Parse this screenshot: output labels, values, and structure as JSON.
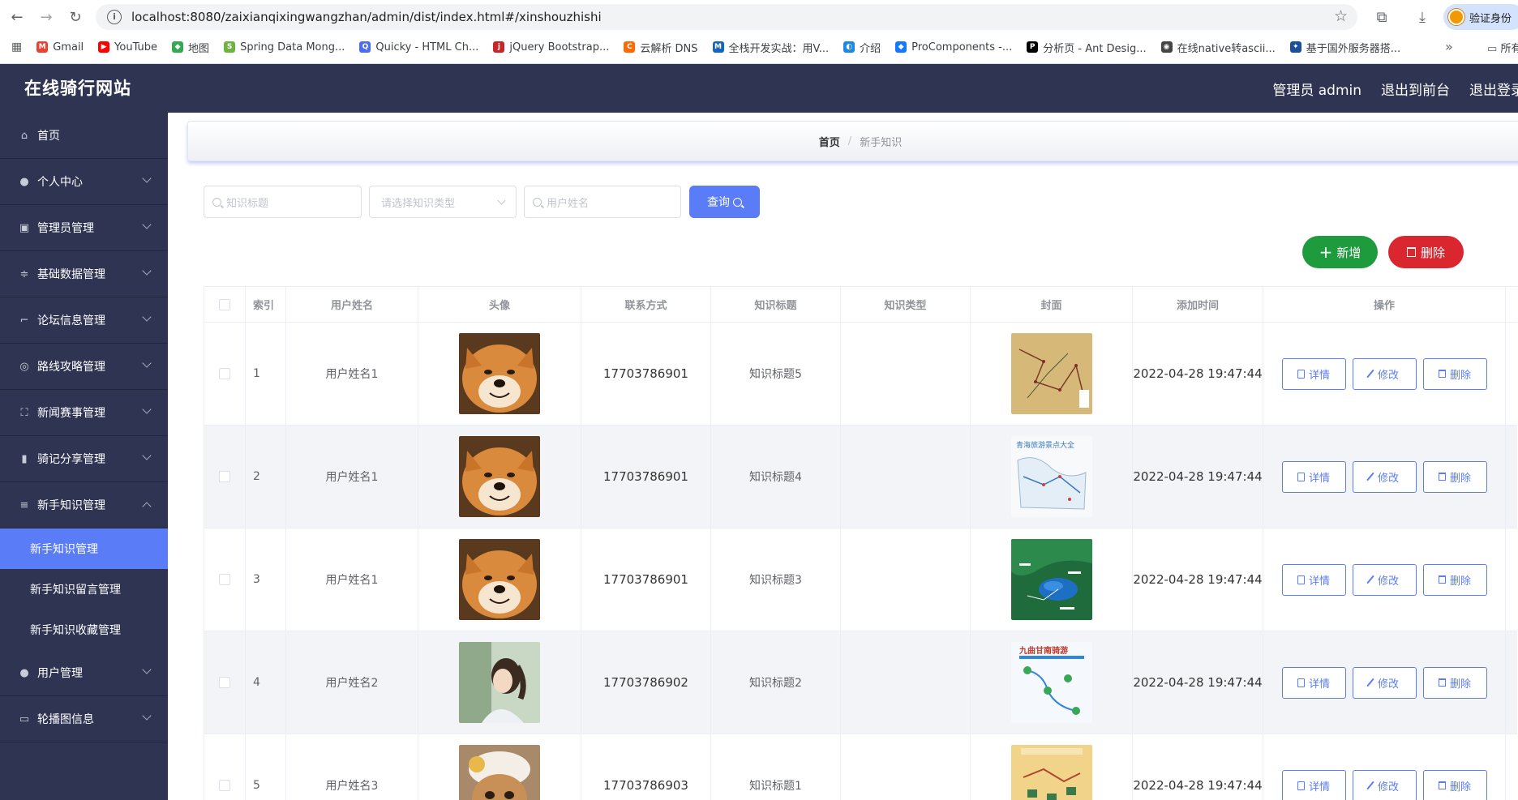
{
  "browser": {
    "url": "localhost:8080/zaixianqixingwangzhan/admin/dist/index.html#/xinshouzhishi",
    "profile_label": "验证身份",
    "bookmarks": [
      {
        "label": "Gmail",
        "color": "#ea4335",
        "glyph": "M"
      },
      {
        "label": "YouTube",
        "color": "#ff0000",
        "glyph": "▶"
      },
      {
        "label": "地图",
        "color": "#34a853",
        "glyph": "◆"
      },
      {
        "label": "Spring Data Mong...",
        "color": "#6db33f",
        "glyph": "S"
      },
      {
        "label": "Quicky - HTML Ch...",
        "color": "#4a6cf7",
        "glyph": "Q"
      },
      {
        "label": "jQuery Bootstrap...",
        "color": "#c62828",
        "glyph": "j"
      },
      {
        "label": "云解析 DNS",
        "color": "#ff6a00",
        "glyph": "C"
      },
      {
        "label": "全栈开发实战：用V...",
        "color": "#1565c0",
        "glyph": "M"
      },
      {
        "label": "介绍",
        "color": "#1e88e5",
        "glyph": "◐"
      },
      {
        "label": "ProComponents -...",
        "color": "#1677ff",
        "glyph": "◆"
      },
      {
        "label": "分析页 - Ant Desig...",
        "color": "#000000",
        "glyph": "P"
      },
      {
        "label": "在线native转ascii...",
        "color": "#444444",
        "glyph": "◉"
      },
      {
        "label": "基于国外服务器搭...",
        "color": "#1a4f9c",
        "glyph": "✦"
      }
    ],
    "bookmarks_overflow": "»",
    "bookmarks_more": "所有"
  },
  "header": {
    "title": "在线骑行网站",
    "admin_label": "管理员 admin",
    "frontend_label": "退出到前台",
    "logout_label": "退出登录"
  },
  "sidebar": {
    "items": [
      {
        "label": "首页",
        "icon": "home-icon",
        "expandable": false
      },
      {
        "label": "个人中心",
        "icon": "user-icon",
        "expandable": true
      },
      {
        "label": "管理员管理",
        "icon": "briefcase-icon",
        "expandable": true
      },
      {
        "label": "基础数据管理",
        "icon": "sliders-icon",
        "expandable": true
      },
      {
        "label": "论坛信息管理",
        "icon": "crop-icon",
        "expandable": true
      },
      {
        "label": "路线攻略管理",
        "icon": "compass-icon",
        "expandable": true
      },
      {
        "label": "新闻赛事管理",
        "icon": "fullscreen-icon",
        "expandable": true
      },
      {
        "label": "骑记分享管理",
        "icon": "bar-chart-icon",
        "expandable": true
      },
      {
        "label": "新手知识管理",
        "icon": "menu-icon",
        "expandable": true,
        "expanded": true,
        "children": [
          {
            "label": "新手知识管理",
            "active": true
          },
          {
            "label": "新手知识留言管理",
            "active": false
          },
          {
            "label": "新手知识收藏管理",
            "active": false
          }
        ]
      },
      {
        "label": "用户管理",
        "icon": "user-icon",
        "expandable": true
      },
      {
        "label": "轮播图信息",
        "icon": "picture-icon",
        "expandable": true
      }
    ]
  },
  "breadcrumb": {
    "home": "首页",
    "separator": "/",
    "current": "新手知识"
  },
  "filters": {
    "title_placeholder": "知识标题",
    "type_placeholder": "请选择知识类型",
    "username_placeholder": "用户姓名",
    "search_label": "查询"
  },
  "actions": {
    "add_label": "新增",
    "delete_label": "删除"
  },
  "table": {
    "columns": [
      "索引",
      "用户姓名",
      "头像",
      "联系方式",
      "知识标题",
      "知识类型",
      "封面",
      "添加时间",
      "操作"
    ],
    "row_actions": {
      "detail": "详情",
      "edit": "修改",
      "delete": "删除"
    },
    "rows": [
      {
        "index": "1",
        "name": "用户姓名1",
        "avatar": "shiba-dog-photo",
        "phone": "17703786901",
        "title": "知识标题5",
        "type": "",
        "cover": "route-map-cover",
        "time": "2022-04-28 19:47:44"
      },
      {
        "index": "2",
        "name": "用户姓名1",
        "avatar": "shiba-dog-photo",
        "phone": "17703786901",
        "title": "知识标题4",
        "type": "",
        "cover": "province-map-cover",
        "cover_text": "青海旅游景点大全",
        "time": "2022-04-28 19:47:44"
      },
      {
        "index": "3",
        "name": "用户姓名1",
        "avatar": "shiba-dog-photo",
        "phone": "17703786901",
        "title": "知识标题3",
        "type": "",
        "cover": "lake-map-cover",
        "time": "2022-04-28 19:47:44"
      },
      {
        "index": "4",
        "name": "用户姓名2",
        "avatar": "girl-portrait-photo",
        "phone": "17703786902",
        "title": "知识标题2",
        "type": "",
        "cover": "gansu-route-cover",
        "cover_text": "九曲甘南骑游",
        "time": "2022-04-28 19:47:44"
      },
      {
        "index": "5",
        "name": "用户姓名3",
        "avatar": "cat-photo",
        "phone": "17703786903",
        "title": "知识标题1",
        "type": "",
        "cover": "travel-map-cover",
        "time": "2022-04-28 19:47:44"
      }
    ]
  },
  "colors": {
    "sidebar_bg": "#2e3452",
    "accent": "#5b7cf7",
    "add_green": "#1e9b3c",
    "delete_red": "#d9262f"
  }
}
